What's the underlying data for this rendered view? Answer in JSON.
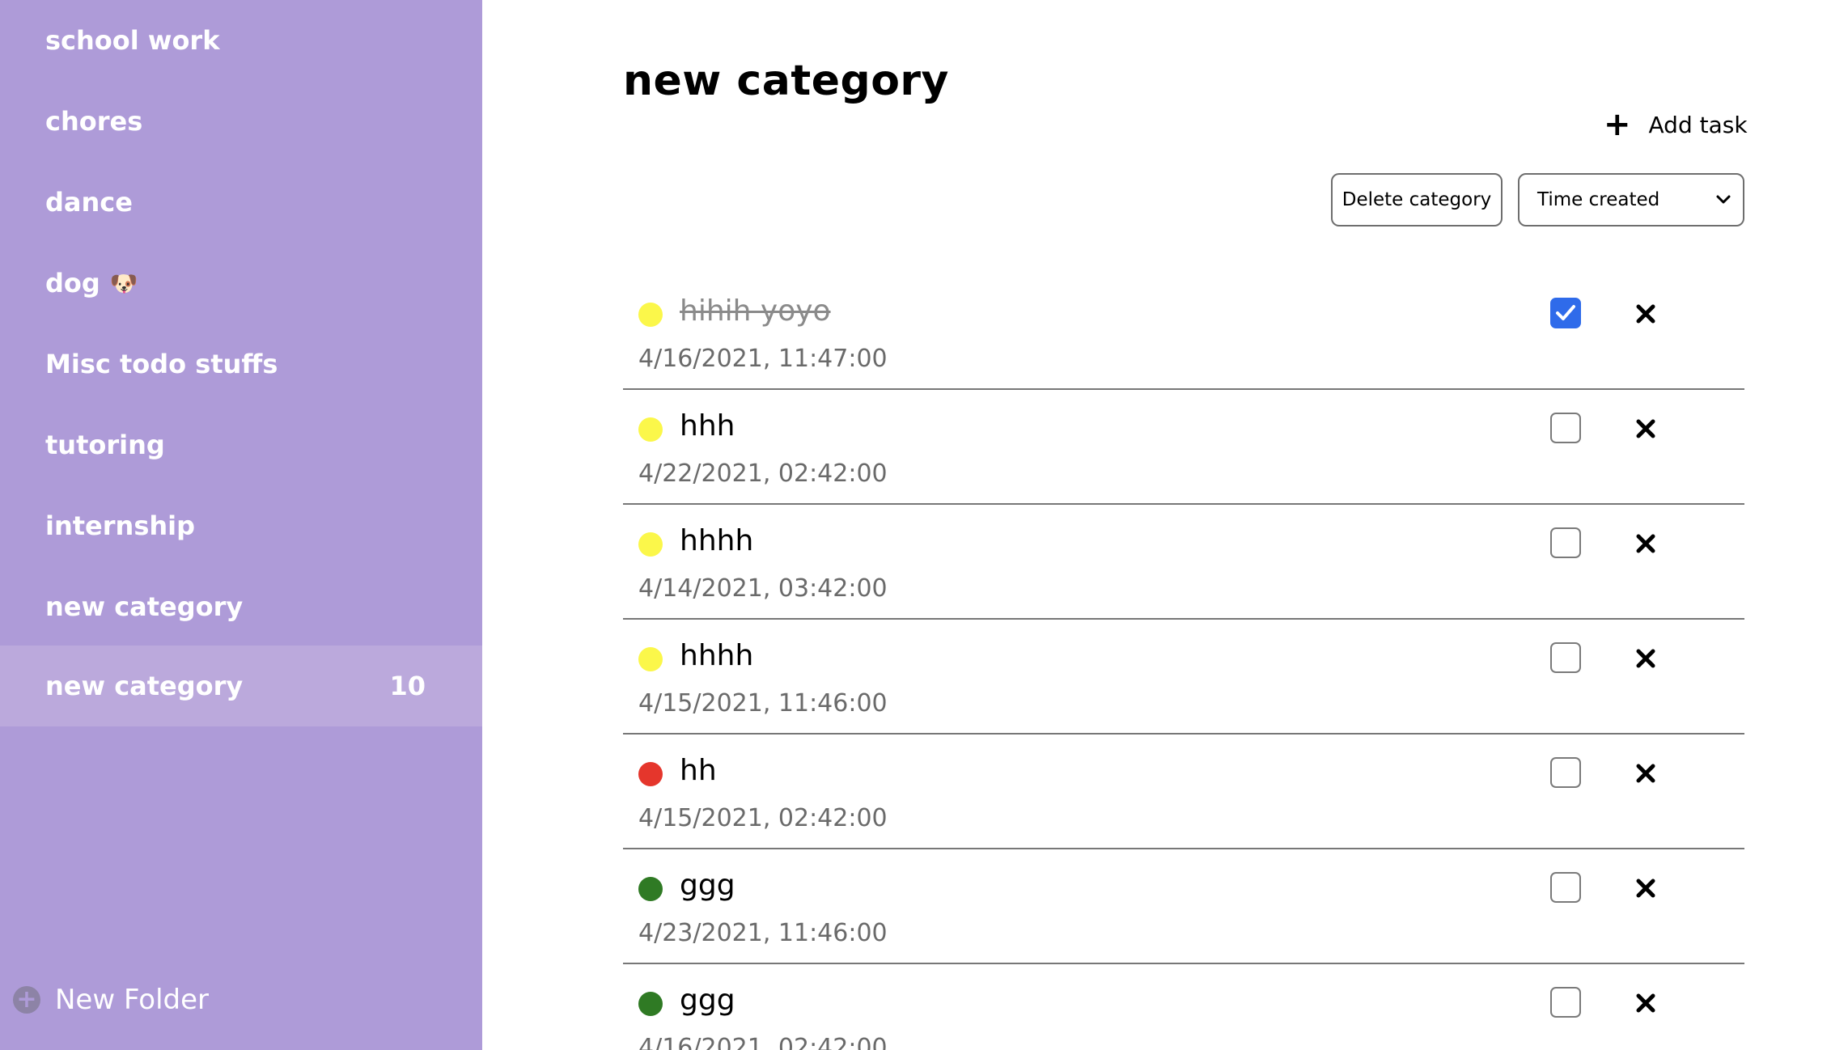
{
  "sidebar": {
    "items": [
      {
        "label": "school work"
      },
      {
        "label": "chores"
      },
      {
        "label": "dance"
      },
      {
        "label": "dog",
        "emoji": "🐶"
      },
      {
        "label": "Misc todo stuffs"
      },
      {
        "label": "tutoring"
      },
      {
        "label": "internship"
      },
      {
        "label": "new category"
      },
      {
        "label": "new category",
        "count": "10",
        "active": true
      }
    ],
    "new_folder_label": "New Folder"
  },
  "main": {
    "title": "new category",
    "add_task_label": "Add task",
    "delete_category_label": "Delete category",
    "sort_select_value": "Time created"
  },
  "colors": {
    "sidebar_bg": "#ae9bd8",
    "sidebar_active_bg": "#bba9dc",
    "priority_low": "#fbf74a",
    "priority_high": "#e5362c",
    "priority_medium": "#2f7a24",
    "checkbox_checked": "#2f6bea"
  },
  "tasks": [
    {
      "title": "hihih yoyo",
      "date": "4/16/2021, 11:47:00",
      "priority_color": "#fbf74a",
      "done": true
    },
    {
      "title": "hhh",
      "date": "4/22/2021, 02:42:00",
      "priority_color": "#fbf74a",
      "done": false
    },
    {
      "title": "hhhh",
      "date": "4/14/2021, 03:42:00",
      "priority_color": "#fbf74a",
      "done": false
    },
    {
      "title": "hhhh",
      "date": "4/15/2021, 11:46:00",
      "priority_color": "#fbf74a",
      "done": false
    },
    {
      "title": "hh",
      "date": "4/15/2021, 02:42:00",
      "priority_color": "#e5362c",
      "done": false
    },
    {
      "title": "ggg",
      "date": "4/23/2021, 11:46:00",
      "priority_color": "#2f7a24",
      "done": false
    },
    {
      "title": "ggg",
      "date": "4/16/2021, 02:42:00",
      "priority_color": "#2f7a24",
      "done": false
    }
  ]
}
